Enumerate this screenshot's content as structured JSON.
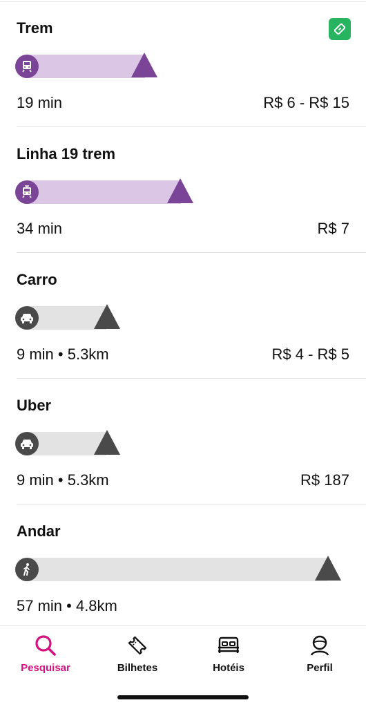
{
  "options": [
    {
      "title": "Trem",
      "meta": "19 min",
      "price": "R$ 6 - R$ 15",
      "icon": "train-icon",
      "color": "#7b4597",
      "has_ticket": true
    },
    {
      "title": "Linha 19 trem",
      "meta": "34 min",
      "price": "R$ 7",
      "icon": "tram-icon",
      "color": "#7b4597",
      "has_ticket": false
    },
    {
      "title": "Carro",
      "meta": "9 min • 5.3km",
      "price": "R$ 4 - R$ 5",
      "icon": "car-icon",
      "color": "#4a4a4a",
      "has_ticket": false
    },
    {
      "title": "Uber",
      "meta": "9 min • 5.3km",
      "price": "R$ 187",
      "icon": "car-icon",
      "color": "#4a4a4a",
      "has_ticket": false
    },
    {
      "title": "Andar",
      "meta": "57 min • 4.8km",
      "price": "",
      "icon": "walking-icon",
      "color": "#4a4a4a",
      "has_ticket": false
    }
  ],
  "tabbar": {
    "tabs": [
      {
        "label": "Pesquisar",
        "icon": "search-icon",
        "active": true
      },
      {
        "label": "Bilhetes",
        "icon": "ticket-icon",
        "active": false
      },
      {
        "label": "Hotéis",
        "icon": "bed-icon",
        "active": false
      },
      {
        "label": "Perfil",
        "icon": "profile-icon",
        "active": false
      }
    ],
    "active_color": "#d4117f"
  }
}
